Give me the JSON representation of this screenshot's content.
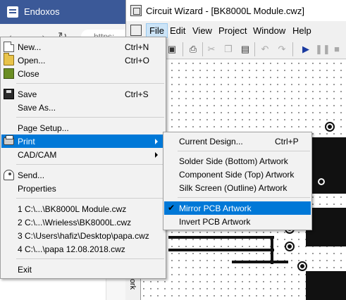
{
  "browser": {
    "title": "Endoxos",
    "url_fragment": "https:"
  },
  "window": {
    "title": "Circuit Wizard - [BK8000L Module.cwz]",
    "menubar": [
      "File",
      "Edit",
      "View",
      "Project",
      "Window",
      "Help"
    ],
    "side_tab_label": "work"
  },
  "file_menu": {
    "items": [
      {
        "label": "New...",
        "shortcut": "Ctrl+N",
        "icon": "new-document-icon"
      },
      {
        "label": "Open...",
        "shortcut": "Ctrl+O",
        "icon": "open-folder-icon"
      },
      {
        "label": "Close",
        "shortcut": "",
        "icon": "close-icon"
      },
      {
        "label": "Save",
        "shortcut": "Ctrl+S",
        "icon": "save-icon"
      },
      {
        "label": "Save As...",
        "shortcut": ""
      },
      {
        "label": "Page Setup...",
        "shortcut": ""
      },
      {
        "label": "Print",
        "shortcut": "",
        "icon": "printer-icon",
        "has_submenu": true
      },
      {
        "label": "CAD/CAM",
        "shortcut": "",
        "has_submenu": true
      },
      {
        "label": "Send...",
        "shortcut": "",
        "icon": "send-icon"
      },
      {
        "label": "Properties",
        "shortcut": ""
      },
      {
        "label": "1 C:\\...\\BK8000L Module.cwz"
      },
      {
        "label": "2 C:\\...\\Wrieless\\BK8000L.cwz"
      },
      {
        "label": "3 C:\\Users\\hafiz\\Desktop\\papa.cwz"
      },
      {
        "label": "4 C:\\...\\papa 12.08.2018.cwz"
      },
      {
        "label": "Exit"
      }
    ]
  },
  "print_menu": {
    "items": [
      {
        "label": "Current Design...",
        "shortcut": "Ctrl+P"
      },
      {
        "label": "Solder Side (Bottom) Artwork"
      },
      {
        "label": "Component Side (Top) Artwork"
      },
      {
        "label": "Silk Screen (Outline) Artwork"
      },
      {
        "label": "Mirror PCB Artwork",
        "checked": true
      },
      {
        "label": "Invert PCB Artwork"
      }
    ]
  },
  "colors": {
    "highlight": "#0078d7",
    "menu_bg": "#f2f2f2",
    "browser_title": "#3b5998"
  }
}
